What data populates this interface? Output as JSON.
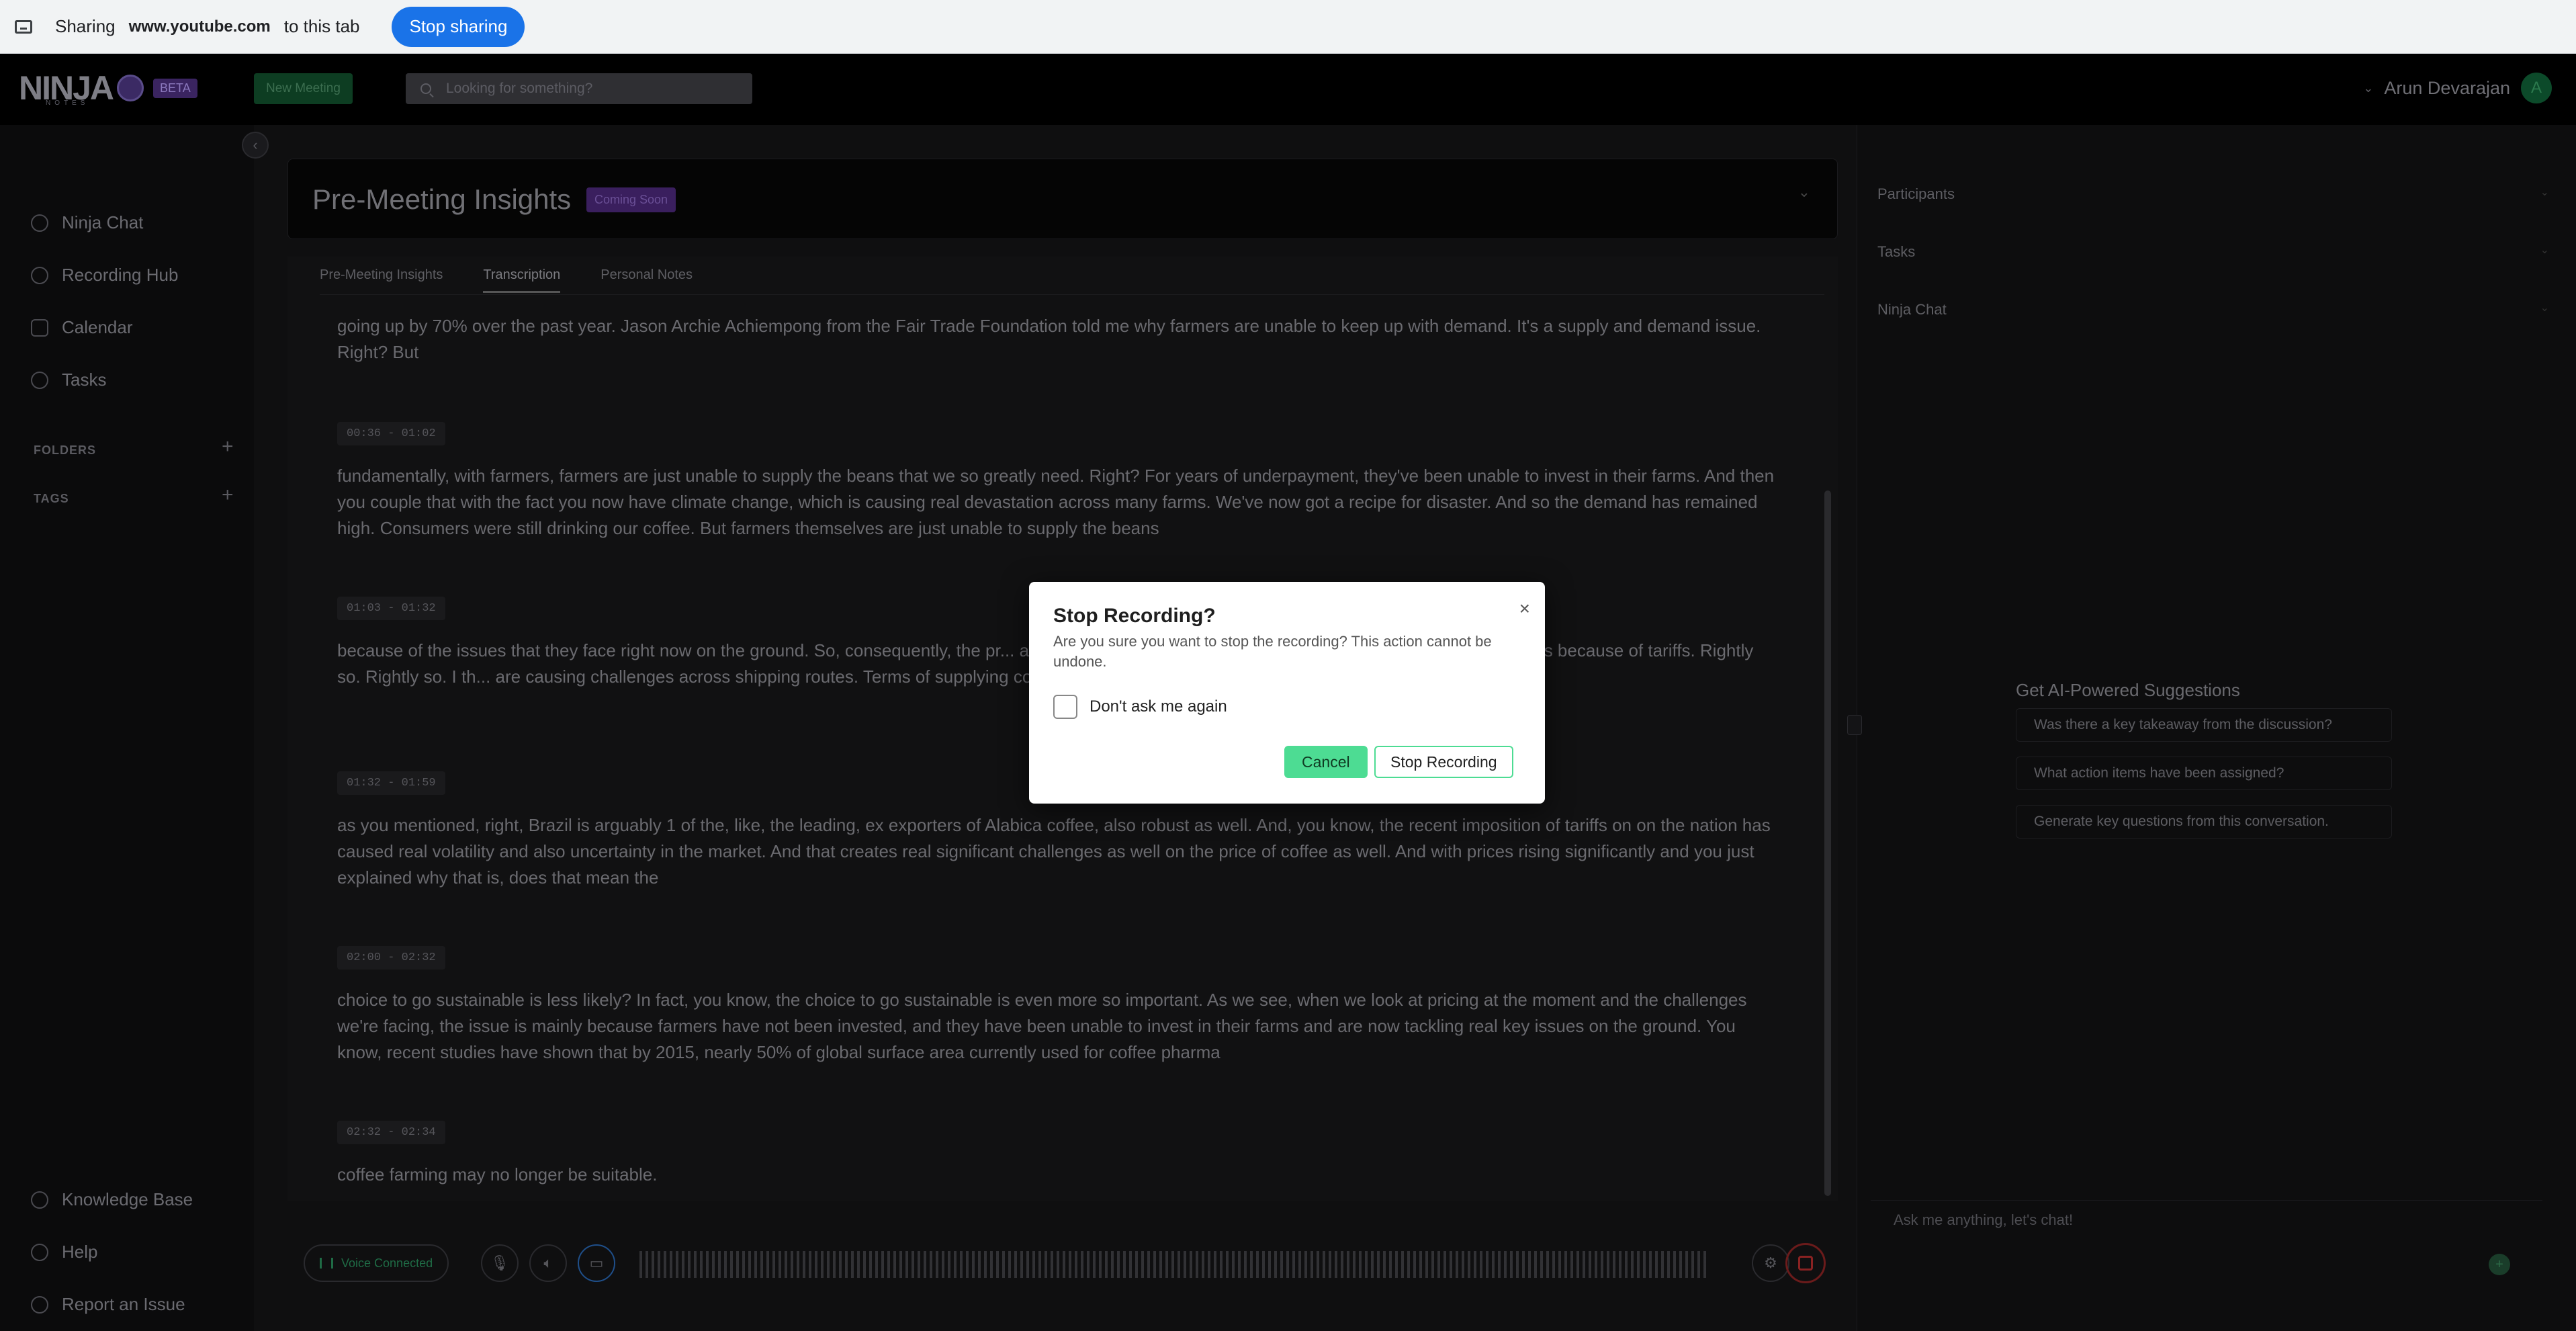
{
  "share_bar": {
    "sharing_label": "Sharing",
    "domain": "www.youtube.com",
    "suffix": "to this tab",
    "stop_button": "Stop sharing"
  },
  "header": {
    "logo_text": "NINJA",
    "logo_subtext": "NOTES",
    "beta": "BETA",
    "new_meeting": "New Meeting",
    "search_placeholder": "Looking for something?",
    "user_name": "Arun Devarajan",
    "avatar_initial": "A"
  },
  "sidebar": {
    "items": [
      {
        "label": "Ninja Chat",
        "icon": "chat-icon"
      },
      {
        "label": "Recording Hub",
        "icon": "microphone-icon"
      },
      {
        "label": "Calendar",
        "icon": "calendar-icon"
      },
      {
        "label": "Tasks",
        "icon": "check-circle-icon"
      }
    ],
    "folders": "FOLDERS",
    "tags": "TAGS",
    "bottom": [
      {
        "label": "Knowledge Base",
        "icon": "book-icon"
      },
      {
        "label": "Help",
        "icon": "help-icon"
      },
      {
        "label": "Report an Issue",
        "icon": "alert-icon"
      }
    ]
  },
  "insights": {
    "title": "Pre-Meeting Insights",
    "badge": "Coming Soon"
  },
  "tabs": [
    "Pre-Meeting Insights",
    "Transcription",
    "Personal Notes"
  ],
  "transcript": [
    {
      "ts": "",
      "text": "going up by 70% over the past year. Jason Archie Achiempong from the Fair Trade Foundation told me why farmers are unable to keep up with demand. It's a supply and demand issue. Right? But"
    },
    {
      "ts": "00:36 - 01:02",
      "text": "fundamentally, with farmers, farmers are just unable to supply the beans that we so greatly need. Right? For years of underpayment, they've been unable to invest in their farms. And then you couple that with the fact you now have climate change, which is causing real devastation across many farms. We've now got a recipe for disaster. And so the demand has remained high. Consumers were still drinking our coffee. But farmers themselves are just unable to supply the beans"
    },
    {
      "ts": "01:03 - 01:32",
      "text": "because of the issues that they face right now on the ground. So, consequently, the pr... are huge consumers. And for them, they're seeing even higher prices because of tariffs. Rightly so. Rightly so. I th... are causing challenges across shipping routes. Terms of supplying coffee out of regions such as East Africa. Bu..."
    },
    {
      "ts": "01:32 - 01:59",
      "text": "as you mentioned, right, Brazil is arguably 1 of the, like, the leading, ex exporters of Alabica coffee, also robust as well. And, you know, the recent imposition of tariffs on on the nation has caused real volatility and also uncertainty in the market. And that creates real significant challenges as well on the price of coffee as well. And with prices rising significantly and you just explained why that is, does that mean the"
    },
    {
      "ts": "02:00 - 02:32",
      "text": "choice to go sustainable is less likely? In fact, you know, the choice to go sustainable is even more so important. As we see, when we look at pricing at the moment and the challenges we're facing, the issue is mainly because farmers have not been invested, and they have been unable to invest in their farms and are now tackling real key issues on the ground. You know, recent studies have shown that by 2015, nearly 50% of global surface area currently used for coffee pharma"
    },
    {
      "ts": "02:32 - 02:34",
      "text": "coffee farming may no longer be suitable."
    }
  ],
  "controls": {
    "voice": "Voice Connected"
  },
  "right_panel": {
    "sections": [
      "Participants",
      "Tasks",
      "Ninja Chat"
    ],
    "suggestions_title": "Get AI-Powered Suggestions",
    "suggestions": [
      "Was there a key takeaway from the discussion?",
      "What action items have been assigned?",
      "Generate key questions from this conversation."
    ],
    "chat_placeholder": "Ask me anything, let's chat!"
  },
  "modal": {
    "title": "Stop Recording?",
    "body": "Are you sure you want to stop the recording? This action cannot be undone.",
    "checkbox_label": "Don't ask me again",
    "cancel": "Cancel",
    "confirm": "Stop Recording"
  }
}
